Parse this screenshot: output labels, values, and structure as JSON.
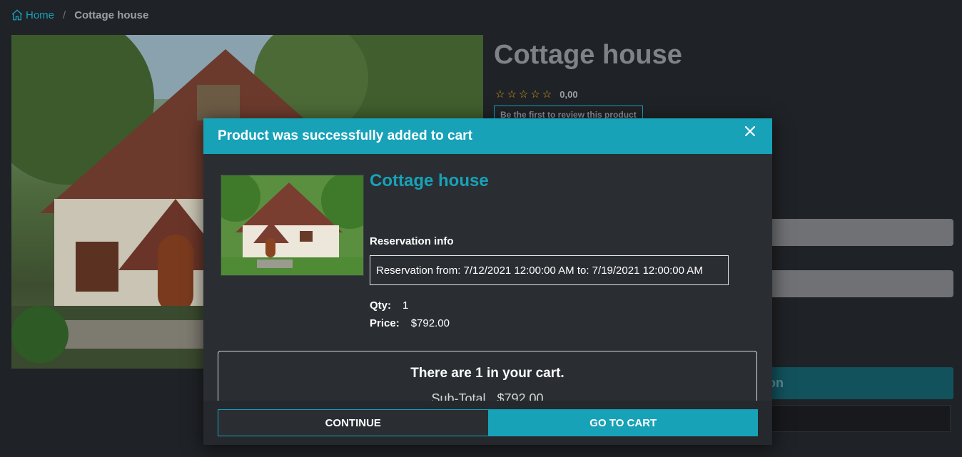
{
  "breadcrumb": {
    "home_label": "Home",
    "separator": "/",
    "current": "Cottage house"
  },
  "product": {
    "title": "Cottage house",
    "stars": "☆☆☆☆☆",
    "rating_value": "0,00",
    "review_link": "Be the first to review this product",
    "reserve_button_partial": "on"
  },
  "modal": {
    "title": "Product was successfully added to cart",
    "product_name": "Cottage house",
    "reservation_label": "Reservation info",
    "reservation_text": "Reservation from: 7/12/2021 12:00:00 AM to: 7/19/2021 12:00:00 AM",
    "qty_label": "Qty:",
    "qty_value": "1",
    "price_label": "Price:",
    "price_value": "$792.00",
    "cart_count_text": "There are 1 in your cart.",
    "subtotal_label": "Sub-Total",
    "subtotal_value": "$792.00",
    "continue_label": "CONTINUE",
    "go_to_cart_label": "GO TO CART"
  },
  "colors": {
    "accent": "#17a2b8",
    "background": "#1f2226",
    "modal_bg": "#2a2e33"
  },
  "icons": {
    "home": "home-icon",
    "close": "close-icon"
  }
}
